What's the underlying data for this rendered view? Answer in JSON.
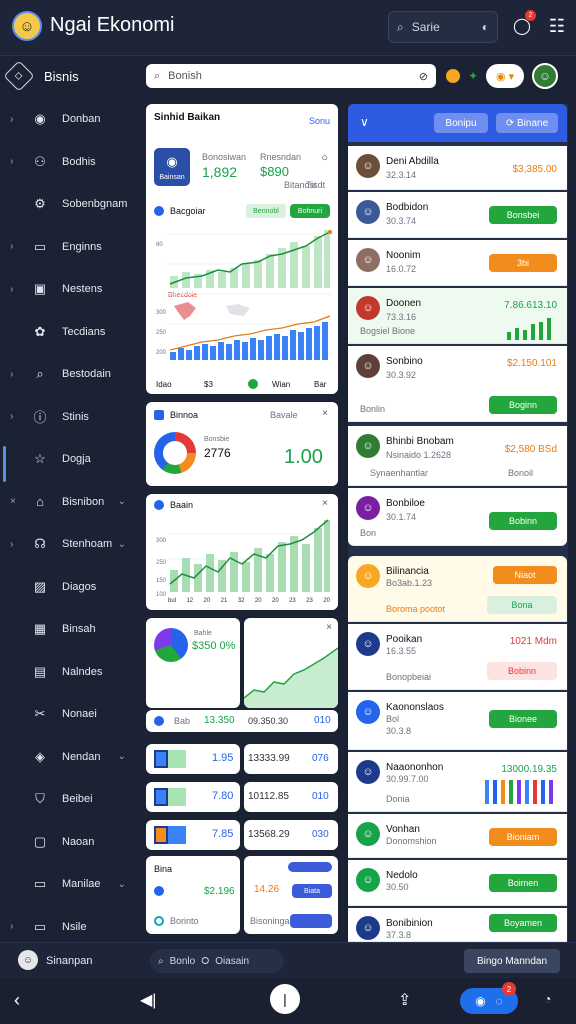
{
  "app": {
    "title": "Ngai Ekonomi",
    "search_placeholder": "Sarie"
  },
  "topbar": {
    "notif_count": "2"
  },
  "sidebar": {
    "header": "Bisnis",
    "items": [
      {
        "label": "Donban",
        "icon": "circle-icon"
      },
      {
        "label": "Bodhis",
        "icon": "people-icon"
      },
      {
        "label": "Sobenbgnam",
        "icon": "gear-icon"
      },
      {
        "label": "Enginns",
        "icon": "terminal-icon"
      },
      {
        "label": "Nestens",
        "icon": "window-icon"
      },
      {
        "label": "Tecdians",
        "icon": "settings-icon"
      },
      {
        "label": "Bestodain",
        "icon": "search-icon"
      },
      {
        "label": "Stinis",
        "icon": "info-icon"
      },
      {
        "label": "Dogja",
        "icon": "star-icon"
      },
      {
        "label": "Bisnibon",
        "icon": "building-icon"
      },
      {
        "label": "Stenhoam",
        "icon": "headset-icon"
      },
      {
        "label": "Diagos",
        "icon": "image-icon"
      },
      {
        "label": "Binsah",
        "icon": "calendar-icon"
      },
      {
        "label": "Nalndes",
        "icon": "book-icon"
      },
      {
        "label": "Nonaei",
        "icon": "tools-icon"
      },
      {
        "label": "Nendan",
        "icon": "tag-icon"
      },
      {
        "label": "Beibei",
        "icon": "shield-icon"
      },
      {
        "label": "Naoan",
        "icon": "chat-icon"
      },
      {
        "label": "Manilae",
        "icon": "monitor-icon"
      },
      {
        "label": "Nsile",
        "icon": "terminal-icon"
      }
    ]
  },
  "search": {
    "placeholder": "Bonish"
  },
  "summary": {
    "title": "Sinhid Baikan",
    "link": "Sonu",
    "label1": "Bonosiwan",
    "value1": "1,892",
    "label2": "Rnesndan",
    "value2": "$890",
    "sub1": "Bainsan",
    "sub2": "Bitanosi",
    "sub3": "Tisdt"
  },
  "growth": {
    "title": "Bacgoiar",
    "tag1": "Bennobl",
    "tag2": "Bohnuri",
    "axis": [
      "80",
      "300",
      "250",
      "200"
    ],
    "note": "Bhecdoie",
    "foot": [
      "Idao",
      "$3",
      "Wian",
      "Bar"
    ]
  },
  "pie": {
    "title": "Binnoa",
    "label": "Bonsbie",
    "value": "2776",
    "sub": "Bavale",
    "big": "1.00"
  },
  "bars2": {
    "title": "Baain",
    "axis": [
      "300",
      "250",
      "150",
      "100"
    ],
    "foot": [
      "bul",
      "12",
      "20",
      "21",
      "32",
      "20",
      "20",
      "23",
      "23",
      "20"
    ]
  },
  "mini": {
    "title": "Bahle",
    "value": "$350",
    "pct": "0%",
    "foot_a": "Bab",
    "foot_b": "13.350",
    "foot_c": "09.350.30",
    "foot_d": "010"
  },
  "rows_mid": [
    {
      "a": "1.95",
      "b": "13333.99",
      "c": "076"
    },
    {
      "a": "7.80",
      "b": "10112.85",
      "c": "010"
    },
    {
      "a": "7.85",
      "b": "13568.29",
      "c": "030"
    }
  ],
  "bottom_mid": {
    "title": "Bina",
    "v1": "$2.196",
    "v2": "14.26",
    "chip": "Biata",
    "foot": "Borinto",
    "foot2": "Bisoninga"
  },
  "right": {
    "chip1": "Bonipu",
    "chip2": "Binane",
    "rows": [
      {
        "name": "Deni Abdilla",
        "sub": "32.3.14",
        "amt": "$3,385.00"
      },
      {
        "name": "Bodbidon",
        "sub": "30.3.74",
        "btn": "Bonsbei"
      },
      {
        "name": "Noonim",
        "sub": "16.0.72",
        "btn": "3bi"
      },
      {
        "name": "Doonen",
        "sub": "73.3.16",
        "amt": "7.86.613.10",
        "foot": "Bogsiel Bione"
      },
      {
        "name": "Sonbino",
        "sub": "30.3.92",
        "amt": "$2.150.101",
        "foot": "Bonlin",
        "btn": "Boginn"
      },
      {
        "name": "Bhinbi Bnobam",
        "sub": "Nsinaido 1.2628",
        "amt": "$2,580 BSd",
        "foot": "Synaenhantlar",
        "foot2": "Bonoil"
      },
      {
        "name": "Bonbiloe",
        "sub": "30.1.74",
        "foot": "Bon",
        "btn": "Bobinn"
      }
    ],
    "rows2": [
      {
        "name": "Bilinancia",
        "sub": "Bo3ab.1.23",
        "foot": "Boroma pootot",
        "btn": "Niaot",
        "btn2": "Bona"
      },
      {
        "name": "Pooikan",
        "sub": "16.3.55",
        "foot": "Bonopbeiai",
        "amt": "1021 Mdm",
        "btn": "Bobinn"
      },
      {
        "name": "Kaononslaos",
        "sub": "Bol",
        "sub2": "30.3.8",
        "btn": "Bionee"
      },
      {
        "name": "Naaononhon",
        "sub": "30.99.7.00",
        "foot": "Donia",
        "amt": "13000.19.35"
      },
      {
        "name": "Vonhan",
        "sub": "Donomshion",
        "btn": "Bioniam"
      },
      {
        "name": "Nedolo",
        "sub": "30.50",
        "btn": "Boimen"
      },
      {
        "name": "Bonibinion",
        "sub": "37.3.8",
        "btn": "Boyamen"
      }
    ]
  },
  "bottombar": {
    "user": "Sinanpan",
    "seg1": "Bonlo",
    "seg2": "Oiasain",
    "btn": "Bingo Manndan"
  },
  "navbar": {
    "badge": "2"
  },
  "colors": {
    "accent": "#2f5be3",
    "green": "#22a63d",
    "orange": "#f28c1c"
  }
}
